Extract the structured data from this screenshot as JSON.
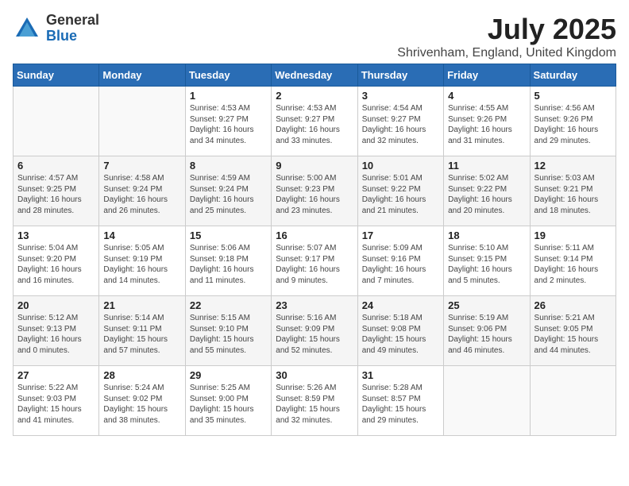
{
  "header": {
    "logo_general": "General",
    "logo_blue": "Blue",
    "title": "July 2025",
    "subtitle": "Shrivenham, England, United Kingdom"
  },
  "weekdays": [
    "Sunday",
    "Monday",
    "Tuesday",
    "Wednesday",
    "Thursday",
    "Friday",
    "Saturday"
  ],
  "weeks": [
    [
      {
        "day": "",
        "info": ""
      },
      {
        "day": "",
        "info": ""
      },
      {
        "day": "1",
        "info": "Sunrise: 4:53 AM\nSunset: 9:27 PM\nDaylight: 16 hours and 34 minutes."
      },
      {
        "day": "2",
        "info": "Sunrise: 4:53 AM\nSunset: 9:27 PM\nDaylight: 16 hours and 33 minutes."
      },
      {
        "day": "3",
        "info": "Sunrise: 4:54 AM\nSunset: 9:27 PM\nDaylight: 16 hours and 32 minutes."
      },
      {
        "day": "4",
        "info": "Sunrise: 4:55 AM\nSunset: 9:26 PM\nDaylight: 16 hours and 31 minutes."
      },
      {
        "day": "5",
        "info": "Sunrise: 4:56 AM\nSunset: 9:26 PM\nDaylight: 16 hours and 29 minutes."
      }
    ],
    [
      {
        "day": "6",
        "info": "Sunrise: 4:57 AM\nSunset: 9:25 PM\nDaylight: 16 hours and 28 minutes."
      },
      {
        "day": "7",
        "info": "Sunrise: 4:58 AM\nSunset: 9:24 PM\nDaylight: 16 hours and 26 minutes."
      },
      {
        "day": "8",
        "info": "Sunrise: 4:59 AM\nSunset: 9:24 PM\nDaylight: 16 hours and 25 minutes."
      },
      {
        "day": "9",
        "info": "Sunrise: 5:00 AM\nSunset: 9:23 PM\nDaylight: 16 hours and 23 minutes."
      },
      {
        "day": "10",
        "info": "Sunrise: 5:01 AM\nSunset: 9:22 PM\nDaylight: 16 hours and 21 minutes."
      },
      {
        "day": "11",
        "info": "Sunrise: 5:02 AM\nSunset: 9:22 PM\nDaylight: 16 hours and 20 minutes."
      },
      {
        "day": "12",
        "info": "Sunrise: 5:03 AM\nSunset: 9:21 PM\nDaylight: 16 hours and 18 minutes."
      }
    ],
    [
      {
        "day": "13",
        "info": "Sunrise: 5:04 AM\nSunset: 9:20 PM\nDaylight: 16 hours and 16 minutes."
      },
      {
        "day": "14",
        "info": "Sunrise: 5:05 AM\nSunset: 9:19 PM\nDaylight: 16 hours and 14 minutes."
      },
      {
        "day": "15",
        "info": "Sunrise: 5:06 AM\nSunset: 9:18 PM\nDaylight: 16 hours and 11 minutes."
      },
      {
        "day": "16",
        "info": "Sunrise: 5:07 AM\nSunset: 9:17 PM\nDaylight: 16 hours and 9 minutes."
      },
      {
        "day": "17",
        "info": "Sunrise: 5:09 AM\nSunset: 9:16 PM\nDaylight: 16 hours and 7 minutes."
      },
      {
        "day": "18",
        "info": "Sunrise: 5:10 AM\nSunset: 9:15 PM\nDaylight: 16 hours and 5 minutes."
      },
      {
        "day": "19",
        "info": "Sunrise: 5:11 AM\nSunset: 9:14 PM\nDaylight: 16 hours and 2 minutes."
      }
    ],
    [
      {
        "day": "20",
        "info": "Sunrise: 5:12 AM\nSunset: 9:13 PM\nDaylight: 16 hours and 0 minutes."
      },
      {
        "day": "21",
        "info": "Sunrise: 5:14 AM\nSunset: 9:11 PM\nDaylight: 15 hours and 57 minutes."
      },
      {
        "day": "22",
        "info": "Sunrise: 5:15 AM\nSunset: 9:10 PM\nDaylight: 15 hours and 55 minutes."
      },
      {
        "day": "23",
        "info": "Sunrise: 5:16 AM\nSunset: 9:09 PM\nDaylight: 15 hours and 52 minutes."
      },
      {
        "day": "24",
        "info": "Sunrise: 5:18 AM\nSunset: 9:08 PM\nDaylight: 15 hours and 49 minutes."
      },
      {
        "day": "25",
        "info": "Sunrise: 5:19 AM\nSunset: 9:06 PM\nDaylight: 15 hours and 46 minutes."
      },
      {
        "day": "26",
        "info": "Sunrise: 5:21 AM\nSunset: 9:05 PM\nDaylight: 15 hours and 44 minutes."
      }
    ],
    [
      {
        "day": "27",
        "info": "Sunrise: 5:22 AM\nSunset: 9:03 PM\nDaylight: 15 hours and 41 minutes."
      },
      {
        "day": "28",
        "info": "Sunrise: 5:24 AM\nSunset: 9:02 PM\nDaylight: 15 hours and 38 minutes."
      },
      {
        "day": "29",
        "info": "Sunrise: 5:25 AM\nSunset: 9:00 PM\nDaylight: 15 hours and 35 minutes."
      },
      {
        "day": "30",
        "info": "Sunrise: 5:26 AM\nSunset: 8:59 PM\nDaylight: 15 hours and 32 minutes."
      },
      {
        "day": "31",
        "info": "Sunrise: 5:28 AM\nSunset: 8:57 PM\nDaylight: 15 hours and 29 minutes."
      },
      {
        "day": "",
        "info": ""
      },
      {
        "day": "",
        "info": ""
      }
    ]
  ]
}
